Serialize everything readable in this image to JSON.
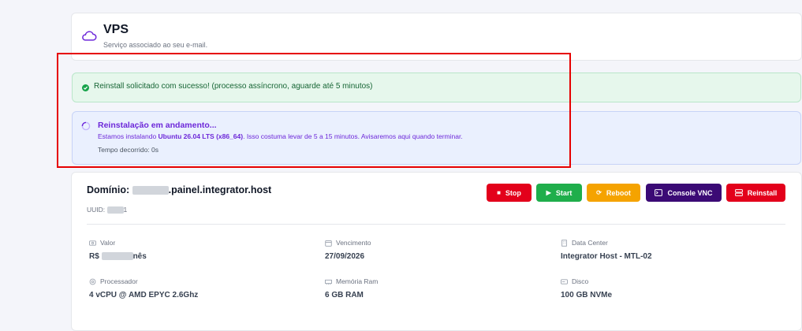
{
  "header": {
    "title": "VPS",
    "subtitle": "Serviço associado ao seu e-mail."
  },
  "alerts": {
    "success": "Reinstall solicitado com sucesso! (processo assíncrono, aguarde até 5 minutos)",
    "info": {
      "title": "Reinstalação em andamento...",
      "line_prefix": "Estamos instalando ",
      "os": "Ubuntu 26.04 LTS (x86_64)",
      "line_suffix": ". Isso costuma levar de 5 a 15 minutos. Avisaremos aqui quando terminar.",
      "elapsed": "Tempo decorrido: 0s"
    }
  },
  "server": {
    "domain_label": "Domínio: ",
    "domain_suffix": ".painel.integrator.host",
    "uuid_label": "UUID: ",
    "uuid_suffix": "1"
  },
  "actions": {
    "stop": "Stop",
    "start": "Start",
    "reboot": "Reboot",
    "console": "Console VNC",
    "reinstall": "Reinstall"
  },
  "specs": {
    "valor": {
      "label": "Valor",
      "prefix": "R$ ",
      "suffix": "nês"
    },
    "vencimento": {
      "label": "Vencimento",
      "value": "27/09/2026"
    },
    "datacenter": {
      "label": "Data Center",
      "value": "Integrator Host - MTL-02"
    },
    "processador": {
      "label": "Processador",
      "value": "4 vCPU @ AMD EPYC 2.6Ghz"
    },
    "memoria": {
      "label": "Memória Ram",
      "value": "6 GB RAM"
    },
    "disco": {
      "label": "Disco",
      "value": "100 GB NVMe"
    }
  },
  "colors": {
    "stop": "#e3001b",
    "start": "#1fae4b",
    "reboot": "#f5a300",
    "console": "#3b0a75",
    "reinstall": "#e3001b"
  }
}
